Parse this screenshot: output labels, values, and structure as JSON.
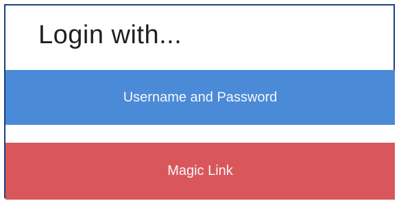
{
  "login_card": {
    "title": "Login with...",
    "buttons": {
      "username_password_label": "Username and Password",
      "magic_link_label": "Magic Link"
    }
  },
  "colors": {
    "primary_button": "#4a8ad6",
    "secondary_button": "#d9575b",
    "border": "#1d3f7a"
  }
}
